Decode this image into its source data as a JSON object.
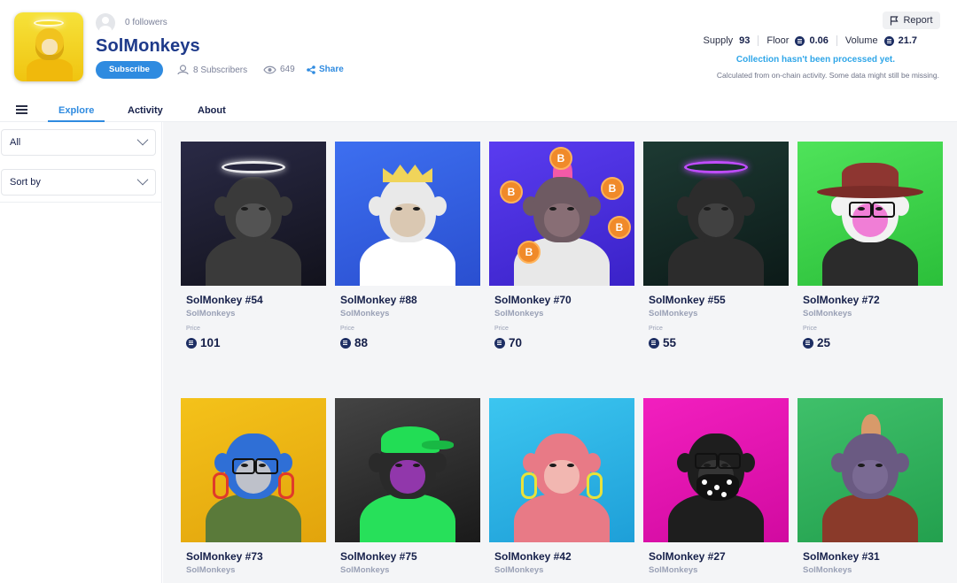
{
  "collection": {
    "followers": "0 followers",
    "name": "SolMonkeys",
    "subscribe_label": "Subscribe",
    "subscribers": "8 Subscribers",
    "views": "649",
    "share_label": "Share",
    "report_label": "Report"
  },
  "stats": {
    "supply_label": "Supply",
    "supply_value": "93",
    "floor_label": "Floor",
    "floor_value": "0.06",
    "volume_label": "Volume",
    "volume_value": "21.7",
    "processed_notice": "Collection hasn't been processed yet.",
    "calc_note": "Calculated from on-chain activity. Some data might still be missing."
  },
  "tabs": [
    {
      "label": "Explore",
      "active": true
    },
    {
      "label": "Activity",
      "active": false
    },
    {
      "label": "About",
      "active": false
    }
  ],
  "filters": {
    "category_value": "All",
    "sort_value": "Sort by"
  },
  "price_label": "Price",
  "items": [
    {
      "name": "SolMonkey #54",
      "collection": "SolMonkeys",
      "price": "101",
      "bg": [
        "#2a2a46",
        "#12121c"
      ],
      "fur": "#3a3a3a",
      "face": "#585858",
      "accessory": "halo"
    },
    {
      "name": "SolMonkey #88",
      "collection": "SolMonkeys",
      "price": "88",
      "bg": [
        "#3d6ff0",
        "#2a4fd0"
      ],
      "fur": "#e9e9e9",
      "face": "#d7c2a8",
      "accessory": "crown"
    },
    {
      "name": "SolMonkey #70",
      "collection": "SolMonkeys",
      "price": "70",
      "bg": [
        "#5a3cf0",
        "#3a22c8"
      ],
      "fur": "#6e5a62",
      "face": "#8d7279",
      "accessory": "coins"
    },
    {
      "name": "SolMonkey #55",
      "collection": "SolMonkeys",
      "price": "55",
      "bg": [
        "#1d3a33",
        "#0c1a18"
      ],
      "fur": "#2c2c2c",
      "face": "#454545",
      "accessory": "halo-purple"
    },
    {
      "name": "SolMonkey #72",
      "collection": "SolMonkeys",
      "price": "25",
      "bg": [
        "#4fe35a",
        "#2bbf3a"
      ],
      "fur": "#f2f2f2",
      "face": "#f06ad1",
      "accessory": "hat"
    },
    {
      "name": "SolMonkey #73",
      "collection": "SolMonkeys",
      "price": "",
      "bg": [
        "#f4c21a",
        "#e2a40c"
      ],
      "fur": "#2f6fd6",
      "face": "#d7d0c8",
      "accessory": "headphones-red"
    },
    {
      "name": "SolMonkey #75",
      "collection": "SolMonkeys",
      "price": "",
      "bg": [
        "#444444",
        "#1a1a1a"
      ],
      "fur": "#2a2a2a",
      "face": "#a33ac2",
      "accessory": "cap"
    },
    {
      "name": "SolMonkey #42",
      "collection": "SolMonkeys",
      "price": "",
      "bg": [
        "#3cc6f0",
        "#1e9fd8"
      ],
      "fur": "#e87a86",
      "face": "#f3c2b8",
      "accessory": "headphones-yellow"
    },
    {
      "name": "SolMonkey #27",
      "collection": "SolMonkeys",
      "price": "",
      "bg": [
        "#f21fbf",
        "#d10aa0"
      ],
      "fur": "#1e1e1e",
      "face": "#3a3a3a",
      "accessory": "mask"
    },
    {
      "name": "SolMonkey #31",
      "collection": "SolMonkeys",
      "price": "",
      "bg": [
        "#3fc06a",
        "#23a04e"
      ],
      "fur": "#6a5a82",
      "face": "#7d6d96",
      "accessory": "mohawk"
    }
  ]
}
